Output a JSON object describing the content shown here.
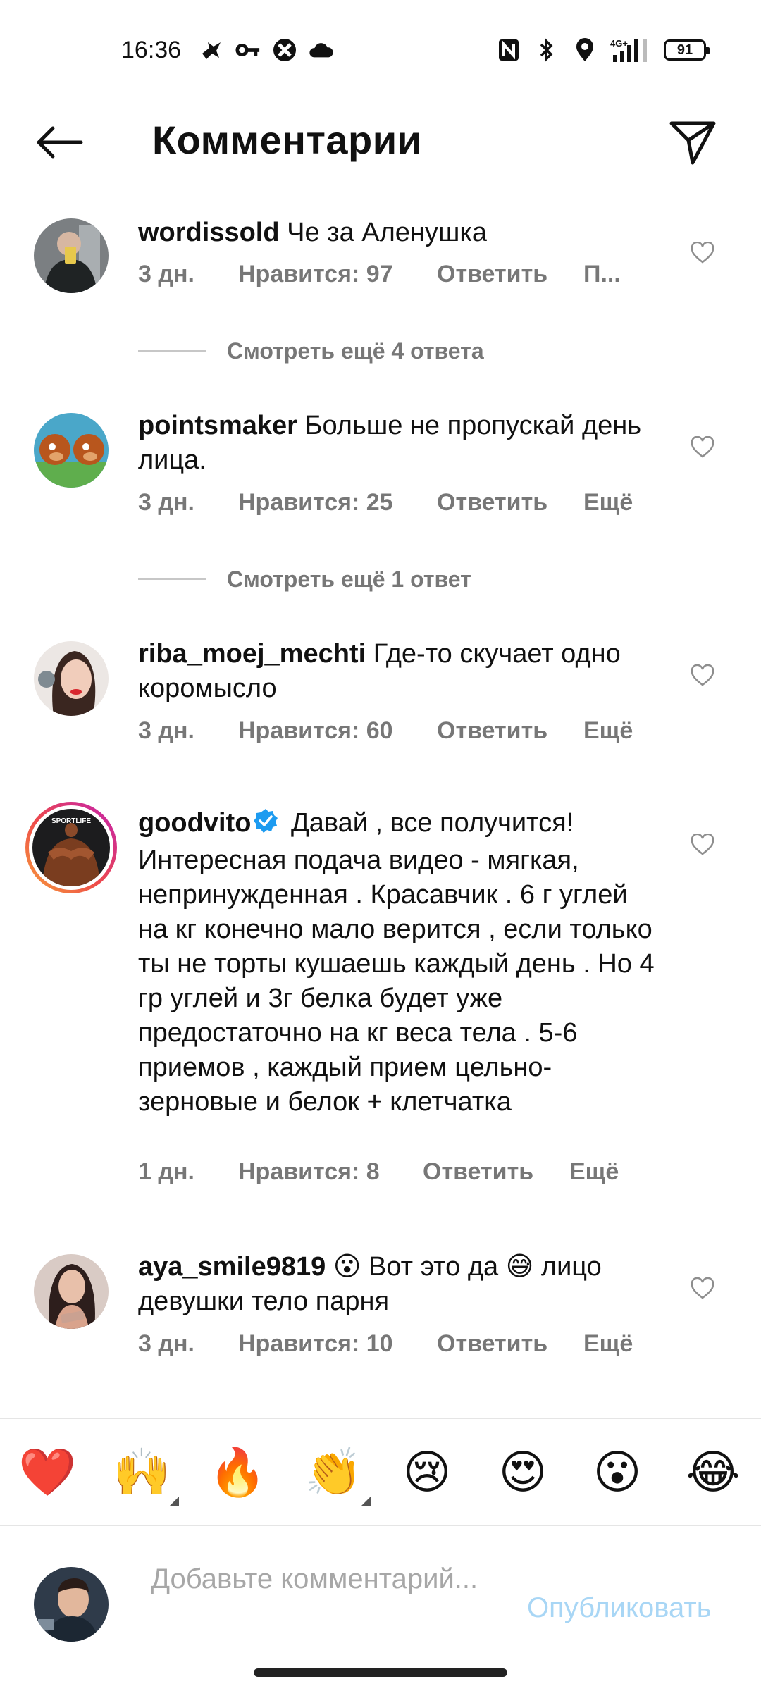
{
  "status_bar": {
    "time": "16:36",
    "battery": "91",
    "network": "4G+",
    "left_icons": [
      "bird-icon",
      "key-icon",
      "vpn-icon",
      "cloud-icon"
    ],
    "right_icons": [
      "nfc-icon",
      "bluetooth-icon",
      "location-icon",
      "signal-icon",
      "battery-icon"
    ]
  },
  "header": {
    "title": "Комментарии"
  },
  "comments": [
    {
      "username": "wordissold",
      "text": "Че за Аленушка",
      "time": "3 дн.",
      "likes": "Нравится: 97",
      "reply": "Ответить",
      "more": "П...",
      "view_replies": "Смотреть ещё 4 ответа"
    },
    {
      "username": "pointsmaker",
      "text": "Больше не пропускай день лица.",
      "time": "3 дн.",
      "likes": "Нравится: 25",
      "reply": "Ответить",
      "more": "Ещё",
      "view_replies": "Смотреть ещё 1 ответ"
    },
    {
      "username": "riba_moej_mechti",
      "text": "Где-то скучает одно коромысло",
      "time": "3 дн.",
      "likes": "Нравится: 60",
      "reply": "Ответить",
      "more": "Ещё"
    },
    {
      "username": "goodvito",
      "verified": true,
      "avatar_label": "SPORTLIFE",
      "text": "Давай , все получится! Интересная подача видео - мягкая, непринужденная . Красавчик . 6 г углей на кг конечно мало верится , если только ты не торты кушаешь каждый день . Но 4 гр углей и 3г белка будет уже предостаточно на кг веса тела . 5-6 приемов , каждый прием цельно-зерновые и белок + клетчатка",
      "time": "1 дн.",
      "likes": "Нравится: 8",
      "reply": "Ответить",
      "more": "Ещё"
    },
    {
      "username": "aya_smile9819",
      "text_parts": [
        "😮",
        "Вот это да",
        "😅",
        "лицо девушки тело парня"
      ],
      "time": "3 дн.",
      "likes": "Нравится: 10",
      "reply": "Ответить",
      "more": "Ещё"
    }
  ],
  "emoji_bar": [
    "❤️",
    "🙌",
    "🔥",
    "👏",
    "😢",
    "😍",
    "😮",
    "😂"
  ],
  "compose": {
    "placeholder": "Добавьте комментарий...",
    "publish": "Опубликовать"
  },
  "colors": {
    "text": "#111111",
    "meta": "#777777",
    "verified": "#1d9bf0",
    "publish_disabled": "#a8d6f5",
    "story_ring_start": "#f7a13a",
    "story_ring_end": "#c21fb1"
  }
}
